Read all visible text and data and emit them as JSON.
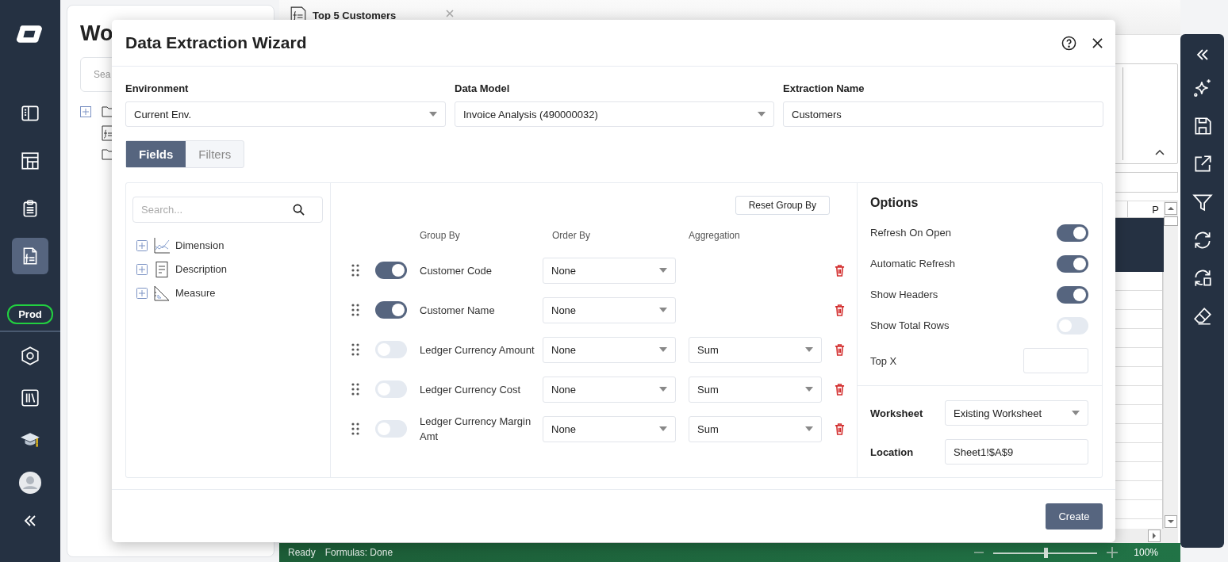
{
  "nav": {
    "items": [
      {
        "selected": false
      },
      {
        "selected": false
      },
      {
        "selected": false
      },
      {
        "selected": true
      }
    ],
    "environment_badge": "Prod"
  },
  "workspace": {
    "title": "Wo",
    "search": {
      "placeholder": "Sea"
    }
  },
  "document_tab": {
    "label": "Top 5 Customers"
  },
  "sheet": {
    "column_header": "P"
  },
  "status_bar": {
    "items": [
      "Ready",
      "Formulas: Done"
    ],
    "zoom": {
      "level": 0.5,
      "reading": "100%"
    }
  },
  "dialog": {
    "title": "Data Extraction Wizard",
    "fields": [
      {
        "label": "Environment",
        "kind": "select",
        "value": "Current Env."
      },
      {
        "label": "Data Model",
        "kind": "select",
        "value": "Invoice Analysis (490000032)"
      },
      {
        "label": "Extraction Name",
        "kind": "text",
        "value": "Customers"
      }
    ],
    "tabs": [
      {
        "label": "Fields",
        "selected": true
      },
      {
        "label": "Filters",
        "selected": false
      }
    ],
    "field_search": {
      "placeholder": "Search..."
    },
    "tree": [
      {
        "label": "Dimension",
        "kind": "dimension",
        "expanded": false
      },
      {
        "label": "Description",
        "kind": "description",
        "expanded": false
      },
      {
        "label": "Measure",
        "kind": "measure",
        "expanded": false
      }
    ],
    "reset_button": "Reset Group By",
    "columns": [
      "Group By",
      "Order By",
      "Aggregation"
    ],
    "rows": [
      {
        "group_by": true,
        "name": "Customer Code",
        "order_by": "None"
      },
      {
        "group_by": true,
        "name": "Customer Name",
        "order_by": "None"
      },
      {
        "group_by": false,
        "name": "Ledger Currency Amount",
        "order_by": "None",
        "aggregation": "Sum"
      },
      {
        "group_by": false,
        "name": "Ledger Currency Cost",
        "order_by": "None",
        "aggregation": "Sum"
      },
      {
        "group_by": false,
        "name": "Ledger Currency Margin Amt",
        "order_by": "None",
        "aggregation": "Sum"
      }
    ],
    "options": {
      "title": "Options",
      "toggles": [
        {
          "label": "Refresh On Open",
          "on": true
        },
        {
          "label": "Automatic Refresh",
          "on": true
        },
        {
          "label": "Show Headers",
          "on": true
        },
        {
          "label": "Show Total Rows",
          "on": false
        }
      ],
      "top_x": {
        "label": "Top X"
      },
      "worksheet": {
        "label": "Worksheet",
        "value": "Existing Worksheet"
      },
      "location": {
        "label": "Location",
        "value": "Sheet1!$A$9"
      }
    },
    "create_button": "Create"
  }
}
